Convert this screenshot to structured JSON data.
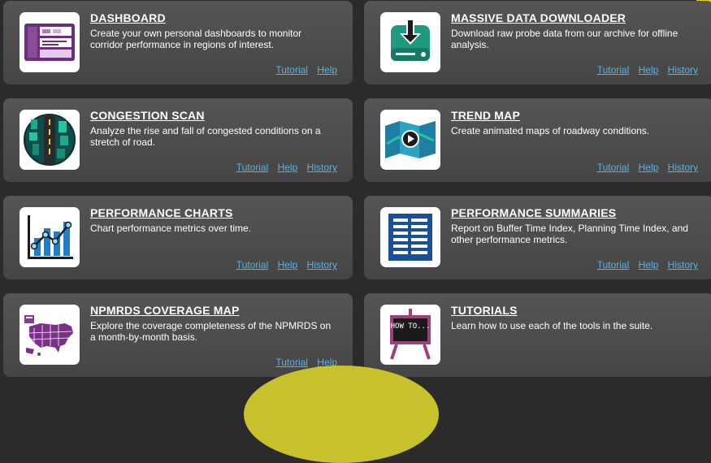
{
  "tiles": [
    {
      "title": "DASHBOARD",
      "desc": "Create your own personal dashboards to monitor corridor performance in regions of interest.",
      "icon": "dashboard-icon",
      "links": [
        "Tutorial",
        "Help"
      ]
    },
    {
      "title": "MASSIVE DATA DOWNLOADER",
      "desc": "Download raw probe data from our archive for offline analysis.",
      "icon": "download-icon",
      "links": [
        "Tutorial",
        "Help",
        "History"
      ]
    },
    {
      "title": "CONGESTION SCAN",
      "desc": "Analyze the rise and fall of congested conditions on a stretch of road.",
      "icon": "congestion-scan-icon",
      "links": [
        "Tutorial",
        "Help",
        "History"
      ]
    },
    {
      "title": "TREND MAP",
      "desc": "Create animated maps of roadway conditions.",
      "icon": "trend-map-icon",
      "links": [
        "Tutorial",
        "Help",
        "History"
      ]
    },
    {
      "title": "PERFORMANCE CHARTS",
      "desc": "Chart performance metrics over time.",
      "icon": "performance-chart-icon",
      "links": [
        "Tutorial",
        "Help",
        "History"
      ]
    },
    {
      "title": "PERFORMANCE SUMMARIES",
      "desc": "Report on Buffer Time Index, Planning Time Index, and other performance metrics.",
      "icon": "performance-summary-icon",
      "links": [
        "Tutorial",
        "Help",
        "History"
      ]
    },
    {
      "title": "NPMRDS COVERAGE MAP",
      "desc": "Explore the coverage completeness of the NPMRDS on a month-by-month basis.",
      "icon": "usa-map-icon",
      "links": [
        "Tutorial",
        "Help"
      ]
    },
    {
      "title": "TUTORIALS",
      "desc": "Learn how to use each of the tools in the suite.",
      "icon": "how-to-easel-icon",
      "links": []
    }
  ],
  "easel_text": "HOW TO...",
  "colors": {
    "link": "#55b5e6",
    "tile_bg": "#4d4d4d",
    "accent_yellow": "#c7c22b"
  }
}
